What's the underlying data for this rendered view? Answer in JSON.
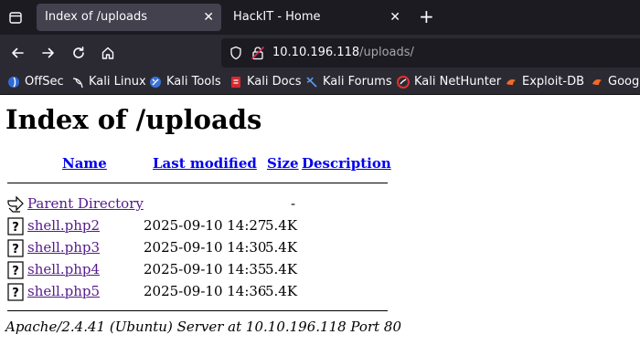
{
  "browser": {
    "tabs": [
      {
        "title": "Index of /uploads",
        "active": true
      },
      {
        "title": "HackIT - Home",
        "active": false
      }
    ],
    "url": {
      "host": "10.10.196.118",
      "path": "/uploads/"
    },
    "bookmarks": [
      {
        "label": "OffSec",
        "icon": "offsec-icon"
      },
      {
        "label": "Kali Linux",
        "icon": "kali-dragon-icon"
      },
      {
        "label": "Kali Tools",
        "icon": "kali-tools-icon"
      },
      {
        "label": "Kali Docs",
        "icon": "kali-docs-icon"
      },
      {
        "label": "Kali Forums",
        "icon": "kali-forums-icon"
      },
      {
        "label": "Kali NetHunter",
        "icon": "nethunter-icon"
      },
      {
        "label": "Exploit-DB",
        "icon": "exploitdb-icon"
      },
      {
        "label": "Googl",
        "icon": "google-hacking-icon"
      }
    ],
    "colors": {
      "tabbar": "#1c1b22",
      "toolbar": "#2b2a33",
      "active_tab": "#42414d"
    }
  },
  "page": {
    "title": "Index of /uploads",
    "columns": [
      "Name",
      "Last modified",
      "Size",
      "Description"
    ],
    "parent": {
      "name": "Parent Directory",
      "size": "-"
    },
    "files": [
      {
        "name": "shell.php2",
        "modified": "2025-09-10 14:27",
        "size": "5.4K"
      },
      {
        "name": "shell.php3",
        "modified": "2025-09-10 14:30",
        "size": "5.4K"
      },
      {
        "name": "shell.php4",
        "modified": "2025-09-10 14:35",
        "size": "5.4K"
      },
      {
        "name": "shell.php5",
        "modified": "2025-09-10 14:36",
        "size": "5.4K"
      }
    ],
    "footer": "Apache/2.4.41 (Ubuntu) Server at 10.10.196.118 Port 80"
  }
}
